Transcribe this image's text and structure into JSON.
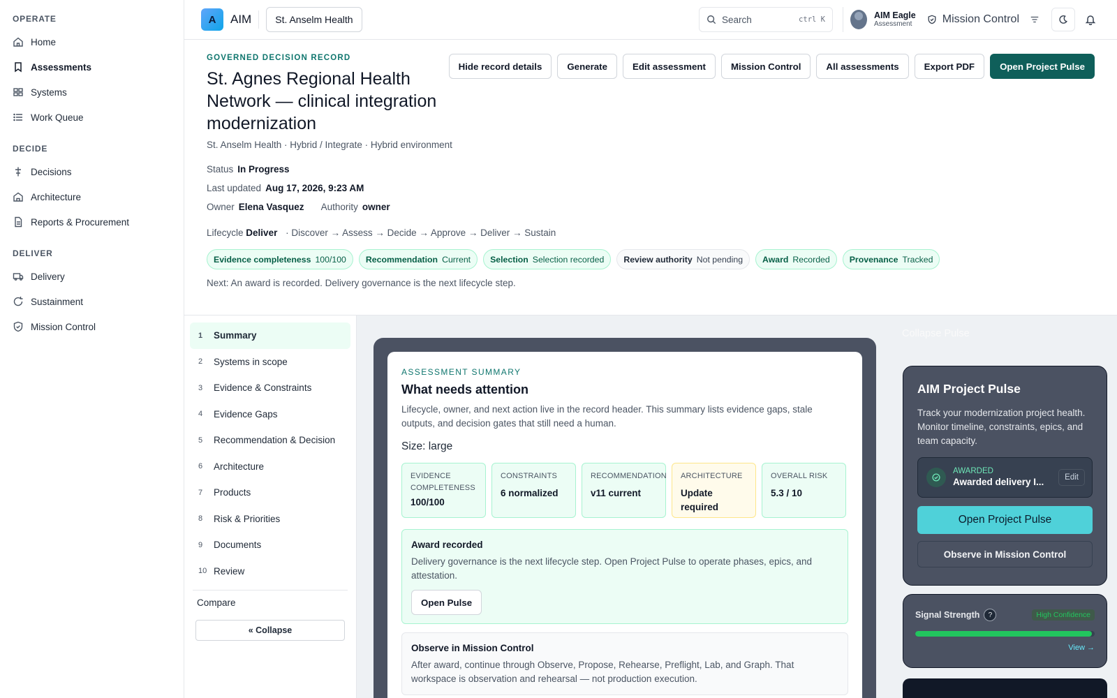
{
  "nav": {
    "sections": [
      {
        "label": "OPERATE",
        "items": [
          {
            "label": "Home",
            "icon": "home-icon"
          },
          {
            "label": "Assessments",
            "icon": "bookmark-icon",
            "active": true
          },
          {
            "label": "Systems",
            "icon": "systems-icon"
          },
          {
            "label": "Work Queue",
            "icon": "list-icon"
          }
        ]
      },
      {
        "label": "DECIDE",
        "items": [
          {
            "label": "Decisions",
            "icon": "decision-icon"
          },
          {
            "label": "Architecture",
            "icon": "building-icon"
          },
          {
            "label": "Reports & Procurement",
            "icon": "document-icon"
          }
        ]
      },
      {
        "label": "DELIVER",
        "items": [
          {
            "label": "Delivery",
            "icon": "truck-icon"
          },
          {
            "label": "Sustainment",
            "icon": "refresh-icon"
          },
          {
            "label": "Mission Control",
            "icon": "shield-icon"
          }
        ]
      }
    ]
  },
  "topbar": {
    "logo_letter": "A",
    "app_name": "AIM",
    "org": "St. Anselm Health",
    "search_placeholder": "Search",
    "search_kbd": "ctrl K",
    "user_name": "AIM Eagle",
    "user_role": "Assessment",
    "mission_control": "Mission Control"
  },
  "record": {
    "eyebrow": "GOVERNED DECISION RECORD",
    "title": "St. Agnes Regional Health Network — clinical integration modernization",
    "subtitle": "St. Anselm Health · Hybrid / Integrate · Hybrid environment",
    "status_label": "Status",
    "status_value": "In Progress",
    "updated_label": "Last updated",
    "updated_value": "Aug 17, 2026, 9:23 AM",
    "owner_label": "Owner",
    "owner_value": "Elena Vasquez",
    "authority_label": "Authority",
    "authority_value": "owner",
    "lifecycle_label": "Lifecycle",
    "lifecycle_value": "Deliver",
    "lifecycle_steps": "·   Discover → Assess → Decide → Approve → Deliver → Sustain",
    "chips": [
      {
        "k": "Evidence completeness",
        "v": "100/100",
        "tone": "green"
      },
      {
        "k": "Recommendation",
        "v": "Current",
        "tone": "green"
      },
      {
        "k": "Selection",
        "v": "Selection recorded",
        "tone": "green"
      },
      {
        "k": "Review authority",
        "v": "Not pending",
        "tone": "neutral"
      },
      {
        "k": "Award",
        "v": "Recorded",
        "tone": "green"
      },
      {
        "k": "Provenance",
        "v": "Tracked",
        "tone": "green"
      }
    ],
    "next": "Next: An award is recorded. Delivery governance is the next lifecycle step.",
    "actions": {
      "hide": "Hide record details",
      "generate": "Generate",
      "edit": "Edit assessment",
      "mission": "Mission Control",
      "all": "All assessments",
      "export": "Export PDF",
      "pulse": "Open Project Pulse"
    }
  },
  "steps": {
    "items": [
      {
        "n": "1",
        "label": "Summary",
        "active": true
      },
      {
        "n": "2",
        "label": "Systems in scope"
      },
      {
        "n": "3",
        "label": "Evidence & Constraints"
      },
      {
        "n": "4",
        "label": "Evidence Gaps"
      },
      {
        "n": "5",
        "label": "Recommendation & Decision"
      },
      {
        "n": "6",
        "label": "Architecture"
      },
      {
        "n": "7",
        "label": "Products"
      },
      {
        "n": "8",
        "label": "Risk & Priorities"
      },
      {
        "n": "9",
        "label": "Documents"
      },
      {
        "n": "10",
        "label": "Review"
      }
    ],
    "compare": "Compare",
    "collapse": "« Collapse"
  },
  "summary": {
    "eyebrow": "ASSESSMENT SUMMARY",
    "title": "What needs attention",
    "desc": "Lifecycle, owner, and next action live in the record header. This summary lists evidence gaps, stale outputs, and decision gates that still need a human.",
    "size": "Size: large",
    "tiles": [
      {
        "label": "EVIDENCE COMPLETENESS",
        "value": "100/100",
        "tone": "green"
      },
      {
        "label": "CONSTRAINTS",
        "value": "6 normalized",
        "tone": "green"
      },
      {
        "label": "RECOMMENDATION",
        "value": "v11 current",
        "tone": "green"
      },
      {
        "label": "ARCHITECTURE",
        "value": "Update required",
        "tone": "warn"
      },
      {
        "label": "OVERALL RISK",
        "value": "5.3 / 10",
        "tone": "green"
      }
    ],
    "award_title": "Award recorded",
    "award_desc": "Delivery governance is the next lifecycle step. Open Project Pulse to operate phases, epics, and attestation.",
    "award_btn": "Open Pulse",
    "observe_title": "Observe in Mission Control",
    "observe_desc": "After award, continue through Observe, Propose, Rehearse, Preflight, Lab, and Graph. That workspace is observation and rehearsal — not production execution."
  },
  "pulse": {
    "collapse": "Collapse Pulse",
    "title": "AIM Project Pulse",
    "desc": "Track your modernization project health. Monitor timeline, constraints, epics, and team capacity.",
    "awarded_tag": "AWARDED",
    "awarded_value": "Awarded delivery I...",
    "edit": "Edit",
    "open": "Open Project Pulse",
    "observe": "Observe in Mission Control"
  },
  "signal": {
    "title": "Signal Strength",
    "badge": "High Confidence",
    "fill_fraction": 0.985,
    "view": "View →",
    "color": "#22c55e"
  }
}
